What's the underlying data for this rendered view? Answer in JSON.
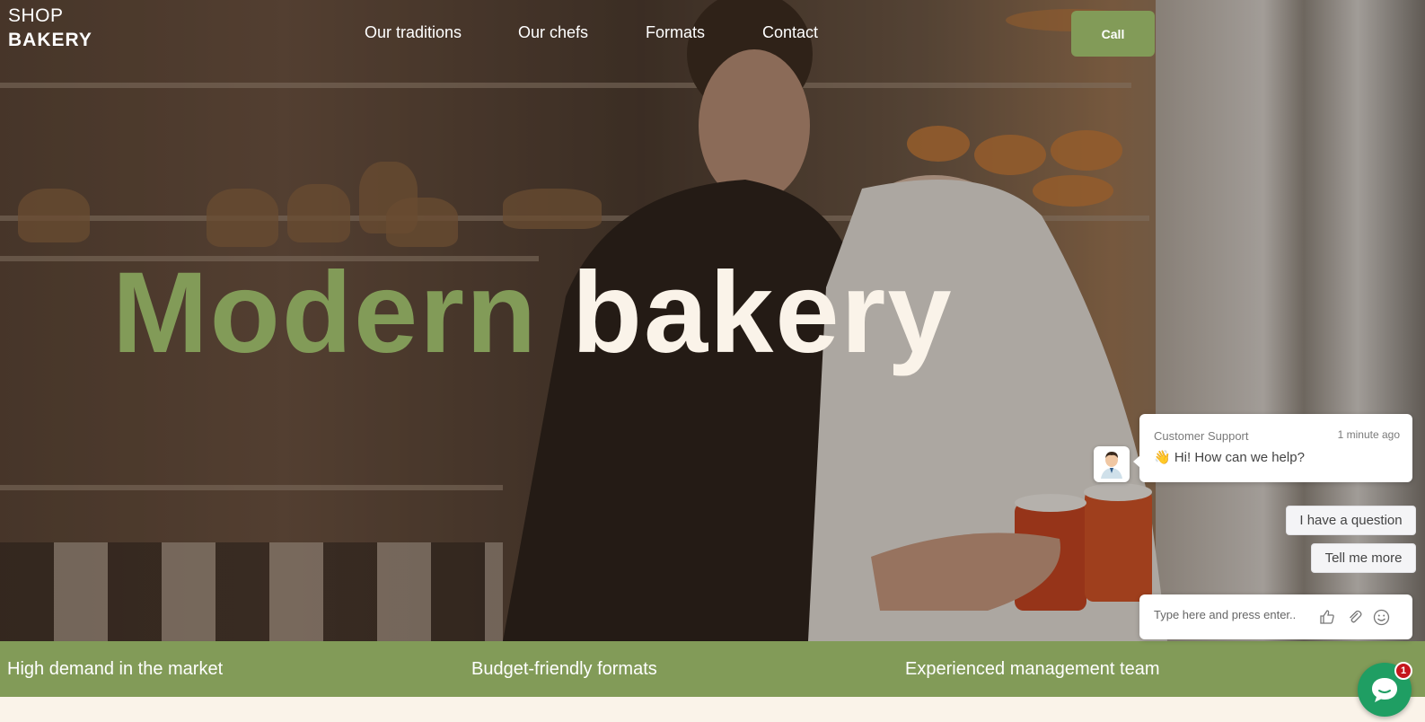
{
  "logo": {
    "line1": "SHOP",
    "line2": "BAKERY"
  },
  "nav": {
    "items": [
      "Our traditions",
      "Our chefs",
      "Formats",
      "Contact"
    ],
    "call_label": "Call"
  },
  "hero": {
    "headline_word1": "Modern",
    "headline_word2": "bakery",
    "accent_color": "#829b58",
    "cream_color": "#faf3e9"
  },
  "features": [
    "High demand in the market",
    "Budget-friendly formats",
    "Experienced management team"
  ],
  "chat": {
    "agent_name": "Customer Support",
    "time_ago": "1 minute ago",
    "greeting": "👋 Hi! How can we help?",
    "quick_replies": [
      "I have a question",
      "Tell me more"
    ],
    "input_placeholder": "Type here and press enter..",
    "unread_count": "1",
    "icons": [
      "thumbs-up-icon",
      "paperclip-icon",
      "smiley-icon",
      "chat-bubble-icon"
    ]
  }
}
